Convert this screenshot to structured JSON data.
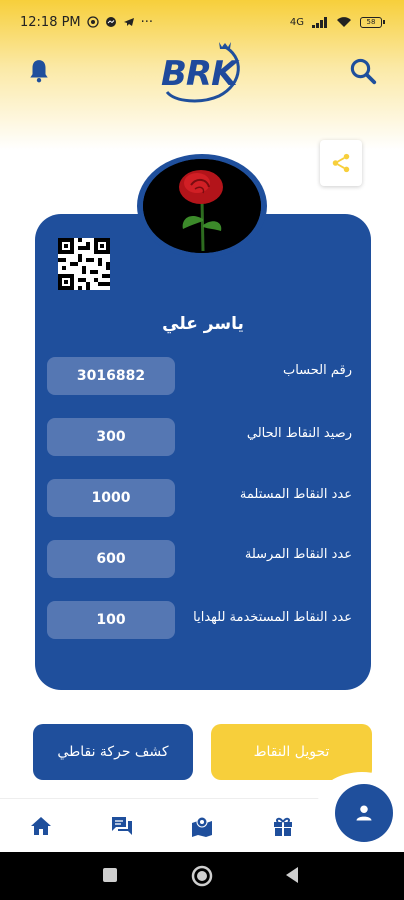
{
  "status_bar": {
    "time": "12:18 PM",
    "signal_label": "4G",
    "battery": "58"
  },
  "header": {
    "logo_text": "BRK"
  },
  "profile": {
    "name": "ياسر علي"
  },
  "rows": [
    {
      "label": "رقم الحساب",
      "value": "3016882"
    },
    {
      "label": "رصيد النقاط الحالي",
      "value": "300"
    },
    {
      "label": "عدد النقاط المستلمة",
      "value": "1000"
    },
    {
      "label": "عدد النقاط المرسلة",
      "value": "600"
    },
    {
      "label": "عدد النقاط المستخدمة للهدايا",
      "value": "100"
    }
  ],
  "actions": {
    "history_label": "كشف حركة نقاطي",
    "transfer_label": "تحويل النقاط"
  },
  "colors": {
    "primary": "#1f4f9c",
    "accent": "#f7cf3b",
    "value_bg": "#5577b3"
  },
  "nav_icons": [
    "home-icon",
    "chat-icon",
    "map-icon",
    "gift-icon",
    "person-icon"
  ]
}
